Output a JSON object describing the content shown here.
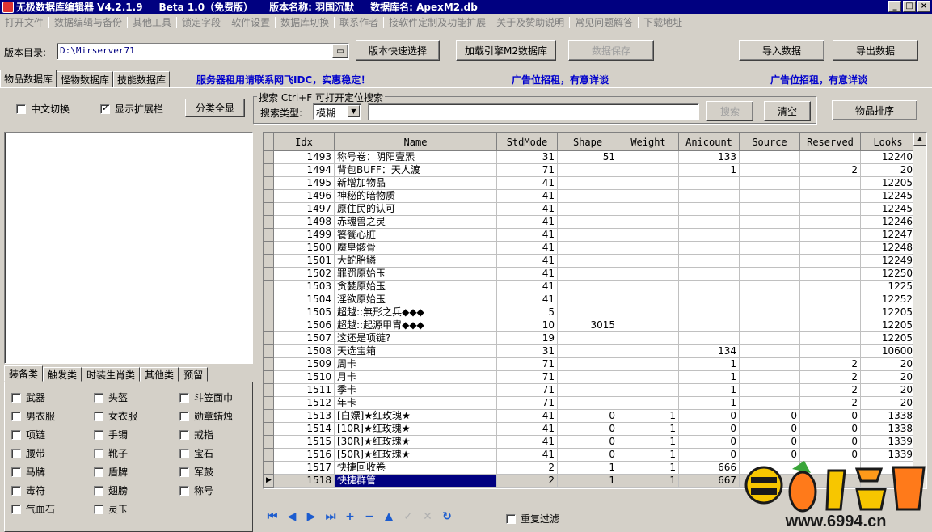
{
  "titlebar": {
    "app": "无极数据库编辑器 V4.2.1.9",
    "beta": "Beta 1.0（免费版）",
    "version_name": "版本名称: 羽国沉默",
    "db_name": "数据库名: ApexM2.db",
    "minimize": "_",
    "maximize": "□",
    "close": "×"
  },
  "menu": [
    "打开文件",
    "数据编辑与备份",
    "其他工具",
    "锁定字段",
    "软件设置",
    "数据库切换",
    "联系作者",
    "接软件定制及功能扩展",
    "关于及赞助说明",
    "常见问题解答",
    "下载地址"
  ],
  "toolbar": {
    "dir_label": "版本目录:",
    "dir_value": "D:\\Mirserver71",
    "quick_select": "版本快速选择",
    "load_engine": "加载引擎M2数据库",
    "save_data": "数据保存",
    "import_data": "导入数据",
    "export_data": "导出数据"
  },
  "tabs": [
    "物品数据库",
    "怪物数据库",
    "技能数据库"
  ],
  "promos": [
    "服务器租用请联系网飞IDC，实惠稳定！",
    "广告位招租，有意详谈",
    "广告位招租，有意详谈"
  ],
  "filters": {
    "chinese_switch": "中文切换",
    "show_extend": "显示扩展栏",
    "show_all": "分类全显"
  },
  "search": {
    "group_title": "搜索  Ctrl+F 可打开定位搜索",
    "type_label": "搜索类型:",
    "type_value": "模糊",
    "search_btn": "搜索",
    "clear_btn": "清空",
    "sort_btn": "物品排序"
  },
  "category_tabs": [
    "装备类",
    "触发类",
    "时装生肖类",
    "其他类",
    "预留"
  ],
  "categories": [
    "武器",
    "头盔",
    "斗笠面巾",
    "男衣服",
    "女衣服",
    "勋章蜡烛",
    "项链",
    "手镯",
    "戒指",
    "腰带",
    "靴子",
    "宝石",
    "马牌",
    "盾牌",
    "军鼓",
    "毒符",
    "翅膀",
    "称号",
    "气血石",
    "灵玉"
  ],
  "grid": {
    "columns": [
      "Idx",
      "Name",
      "StdMode",
      "Shape",
      "Weight",
      "Anicount",
      "Source",
      "Reserved",
      "Looks"
    ],
    "rows": [
      [
        "1493",
        "称号卷：阴阳壹炁",
        "31",
        "51",
        "",
        "133",
        "",
        "",
        "12240"
      ],
      [
        "1494",
        "背包BUFF：天人渡",
        "71",
        "",
        "",
        "1",
        "",
        "2",
        "20"
      ],
      [
        "1495",
        "新增加物品",
        "41",
        "",
        "",
        "",
        "",
        "",
        "12205"
      ],
      [
        "1496",
        "神秘的暗物质",
        "41",
        "",
        "",
        "",
        "",
        "",
        "12245"
      ],
      [
        "1497",
        "原住民的认可",
        "41",
        "",
        "",
        "",
        "",
        "",
        "12245"
      ],
      [
        "1498",
        "赤魂兽之灵",
        "41",
        "",
        "",
        "",
        "",
        "",
        "12246"
      ],
      [
        "1499",
        "饕餮心脏",
        "41",
        "",
        "",
        "",
        "",
        "",
        "12247"
      ],
      [
        "1500",
        "魔皇骸骨",
        "41",
        "",
        "",
        "",
        "",
        "",
        "12248"
      ],
      [
        "1501",
        "大蛇胎鳞",
        "41",
        "",
        "",
        "",
        "",
        "",
        "12249"
      ],
      [
        "1502",
        "罪罚原始玉",
        "41",
        "",
        "",
        "",
        "",
        "",
        "12250"
      ],
      [
        "1503",
        "贪婪原始玉",
        "41",
        "",
        "",
        "",
        "",
        "",
        "1225"
      ],
      [
        "1504",
        "淫欲原始玉",
        "41",
        "",
        "",
        "",
        "",
        "",
        "12252"
      ],
      [
        "1505",
        "超越::無形之兵◆◆◆",
        "5",
        "",
        "",
        "",
        "",
        "",
        "12205"
      ],
      [
        "1506",
        "超越::起源甲胄◆◆◆",
        "10",
        "3015",
        "",
        "",
        "",
        "",
        "12205"
      ],
      [
        "1507",
        "这还是项链?",
        "19",
        "",
        "",
        "",
        "",
        "",
        "12205"
      ],
      [
        "1508",
        "天选宝箱",
        "31",
        "",
        "",
        "134",
        "",
        "",
        "10600"
      ],
      [
        "1509",
        "周卡",
        "71",
        "",
        "",
        "1",
        "",
        "2",
        "20"
      ],
      [
        "1510",
        "月卡",
        "71",
        "",
        "",
        "1",
        "",
        "2",
        "20"
      ],
      [
        "1511",
        "季卡",
        "71",
        "",
        "",
        "1",
        "",
        "2",
        "20"
      ],
      [
        "1512",
        "年卡",
        "71",
        "",
        "",
        "1",
        "",
        "2",
        "20"
      ],
      [
        "1513",
        "[白嫖]★红玫瑰★",
        "41",
        "0",
        "1",
        "0",
        "0",
        "0",
        "1338"
      ],
      [
        "1514",
        "[10R]★红玫瑰★",
        "41",
        "0",
        "1",
        "0",
        "0",
        "0",
        "1338"
      ],
      [
        "1515",
        "[30R]★红玫瑰★",
        "41",
        "0",
        "1",
        "0",
        "0",
        "0",
        "1339"
      ],
      [
        "1516",
        "[50R]★红玫瑰★",
        "41",
        "0",
        "1",
        "0",
        "0",
        "0",
        "1339"
      ],
      [
        "1517",
        "快捷回收卷",
        "2",
        "1",
        "1",
        "666",
        "",
        "",
        ""
      ],
      [
        "1518",
        "快捷群管",
        "2",
        "1",
        "1",
        "667",
        "",
        "",
        ""
      ]
    ],
    "selected_idx": "1518"
  },
  "navigator": {
    "icons": [
      "first-icon",
      "prior-icon",
      "next-icon",
      "last-icon",
      "insert-icon",
      "delete-icon",
      "edit-icon",
      "post-icon",
      "cancel-icon",
      "refresh-icon"
    ],
    "dup_filter": "重复过滤"
  },
  "watermark": {
    "brand": "萝卜论坛",
    "url": "www.6994.cn"
  }
}
